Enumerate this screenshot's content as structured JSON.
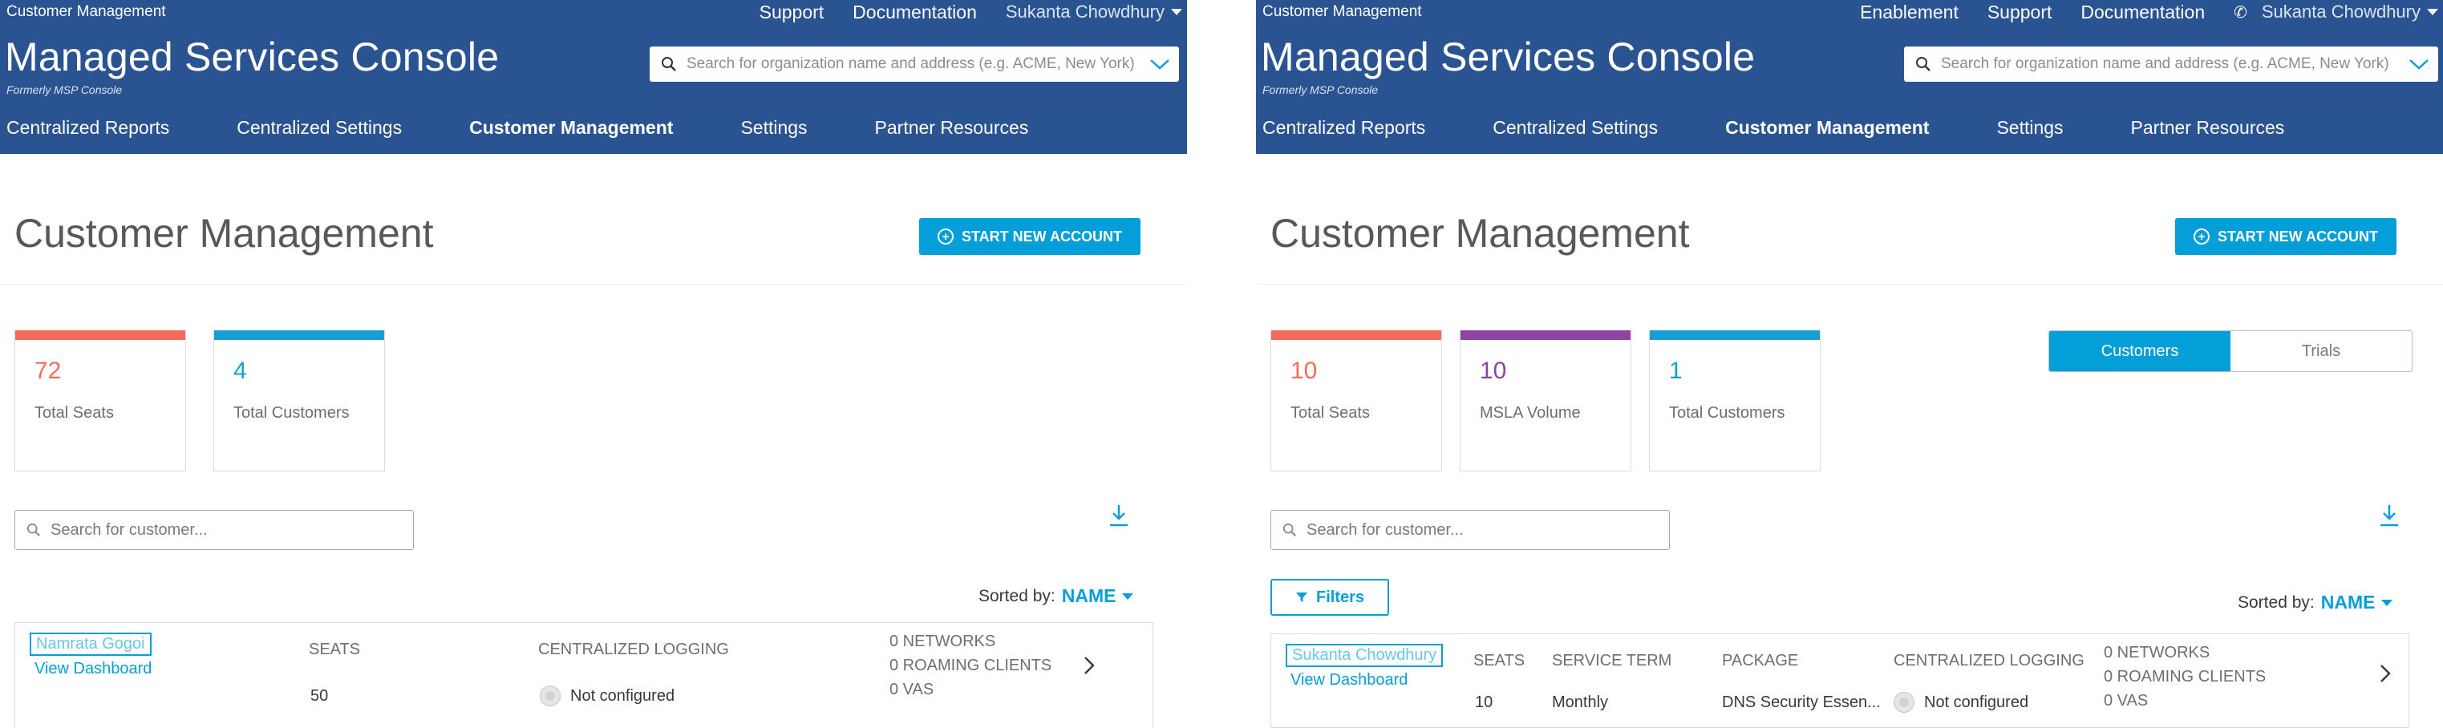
{
  "left": {
    "breadcrumb": "Customer Management",
    "top_links": [
      "Support",
      "Documentation"
    ],
    "user": "Sukanta Chowdhury",
    "brand": "Managed Services Console",
    "subbrand": "Formerly MSP Console",
    "global_search": {
      "placeholder": "Search for organization name and address (e.g. ACME, New York)"
    },
    "nav": [
      "Centralized Reports",
      "Centralized Settings",
      "Customer Management",
      "Settings",
      "Partner Resources"
    ],
    "nav_active": "Customer Management",
    "page_title": "Customer Management",
    "start_button": "START NEW ACCOUNT",
    "cards": [
      {
        "value": "72",
        "label": "Total Seats",
        "color": "#f26b5b"
      },
      {
        "value": "4",
        "label": "Total Customers",
        "color": "#179fd5"
      }
    ],
    "customer_search": {
      "placeholder": "Search for customer..."
    },
    "sorted_by": {
      "label": "Sorted by:",
      "value": "NAME"
    },
    "row": {
      "name": "Namrata Gogoi",
      "view_dashboard": "View Dashboard",
      "seats_header": "SEATS",
      "seats_value": "50",
      "logging_header": "CENTRALIZED LOGGING",
      "logging_value": "Not configured",
      "stats": [
        "0 NETWORKS",
        "0 ROAMING CLIENTS",
        "0 VAS"
      ]
    }
  },
  "right": {
    "breadcrumb": "Customer Management",
    "top_links": [
      "Enablement",
      "Support",
      "Documentation"
    ],
    "user": "Sukanta Chowdhury",
    "brand": "Managed Services Console",
    "subbrand": "Formerly MSP Console",
    "global_search": {
      "placeholder": "Search for organization name and address (e.g. ACME, New York)"
    },
    "nav": [
      "Centralized Reports",
      "Centralized Settings",
      "Customer Management",
      "Settings",
      "Partner Resources"
    ],
    "nav_active": "Customer Management",
    "page_title": "Customer Management",
    "start_button": "START NEW ACCOUNT",
    "cards": [
      {
        "value": "10",
        "label": "Total Seats",
        "color": "#f26b5b"
      },
      {
        "value": "10",
        "label": "MSLA Volume",
        "color": "#8e44a3"
      },
      {
        "value": "1",
        "label": "Total Customers",
        "color": "#179fd5"
      }
    ],
    "toggle": {
      "customers": "Customers",
      "trials": "Trials",
      "selected": "Customers"
    },
    "customer_search": {
      "placeholder": "Search for customer..."
    },
    "filters_button": "Filters",
    "sorted_by": {
      "label": "Sorted by:",
      "value": "NAME"
    },
    "row": {
      "name": "Sukanta Chowdhury",
      "view_dashboard": "View Dashboard",
      "seats_header": "SEATS",
      "seats_value": "10",
      "term_header": "SERVICE TERM",
      "term_value": "Monthly",
      "package_header": "PACKAGE",
      "package_value": "DNS Security Essen...",
      "logging_header": "CENTRALIZED LOGGING",
      "logging_value": "Not configured",
      "stats": [
        "0 NETWORKS",
        "0 ROAMING CLIENTS",
        "0 VAS"
      ]
    }
  },
  "colors": {
    "header": "#2a5392",
    "accent": "#049fd9"
  }
}
